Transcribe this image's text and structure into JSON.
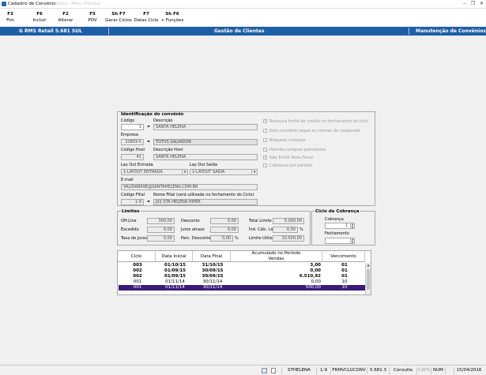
{
  "window": {
    "title": "Cadastro de Convênio",
    "ghost_title": "· Cadastro · Menu Principal"
  },
  "toolbar": [
    {
      "key": "F3",
      "label": "Fim"
    },
    {
      "key": "F6",
      "label": "Incluir"
    },
    {
      "key": "F2",
      "label": "Alterar"
    },
    {
      "key": "F5",
      "label": "PDV"
    },
    {
      "key": "Sh F7",
      "label": "Gerar Ciclos"
    },
    {
      "key": "F7",
      "label": "Datas Ciclo"
    },
    {
      "key": "Sh F6",
      "label": "+ Funções"
    }
  ],
  "header": {
    "app": "G RMS Retail 5.681 SUL",
    "module": "Gestão de Clientes",
    "screen": "Manutenção de Convênios"
  },
  "identificacao": {
    "title": "Identificação do convênio",
    "codigo_label": "Código",
    "codigo": "1",
    "descricao_label": "Descrição",
    "descricao": "SANTA HELENA",
    "empresa_label": "Empresa",
    "empresa_codigo": "22803-5",
    "empresa_nome": "TOTVS SALVADOR",
    "codigo_host_label": "Código Host",
    "codigo_host": "41",
    "descricao_host_label": "Descrição Host",
    "descricao_host": "SANTA HELENA",
    "layout_entrada_label": "Lay Out Entrada",
    "layout_entrada": "1-LAYOUT ENTRADA",
    "layout_saida_label": "Lay Out Saída",
    "layout_saida": "2-LAYOUT SAÍDA",
    "email_label": "E-mail",
    "email": "VALIDABASE@SANTAHELENA.COM.BR",
    "codigo_filial_label": "Código Filial",
    "codigo_filial": "1-9",
    "nome_filial_label": "Nome Filial (será utilizada no fechamento do Ciclo)",
    "nome_filial": "J01 STA HELENA HIPER"
  },
  "options": [
    {
      "label": "Restaura limite de crédito no fechamento do ciclo",
      "checked": true
    },
    {
      "label": "Este convênio segue as normas de cooperado",
      "checked": false
    },
    {
      "label": "Bloquear compras",
      "checked": false
    },
    {
      "label": "Permite compras parceladas",
      "checked": false
    },
    {
      "label": "Não Emitir Nota Fiscal",
      "checked": true
    },
    {
      "label": "Cobrança por período",
      "checked": false
    }
  ],
  "limites": {
    "title": "Limites",
    "off_line_label": "Off-Line",
    "off_line": "300,00",
    "desconto_label": "Desconto",
    "desconto": "0,00",
    "total_limite_label": "Total Limite",
    "total_limite": "5.000,00",
    "excedido_label": "Excedido",
    "excedido": "0,00",
    "juros_atraso_label": "Juros atraso",
    "juros_atraso": "0,00",
    "ind_calc_label": "Índ. Cálc. Lim.",
    "ind_calc": "0,00",
    "ind_calc_unit": "%",
    "taxa_juros_label": "Taxa de Juros",
    "taxa_juros": "0,00",
    "perc_desconto_label": "Perc. Desconto",
    "perc_desconto": "0,00",
    "perc_unit": "%",
    "limite_utilizado_label": "Limite Utilizado",
    "limite_utilizado": "10.500,00"
  },
  "ciclo": {
    "title": "Ciclo de Cobrança",
    "cobranca_label": "Cobrança",
    "cobranca": "1",
    "fechamento_label": "Fechamento",
    "fechamento": ""
  },
  "grid": {
    "headers": {
      "ciclo": "Ciclo",
      "data_inicial": "Data Inicial",
      "data_final": "Data Final",
      "acumulado": "Acumulado no Período",
      "vendas": "Vendas",
      "vencimento": "Vencimento"
    },
    "rows": [
      {
        "ciclo": "003",
        "inicio": "01/10/15",
        "fim": "31/10/15",
        "vendas": "3,00",
        "venc": "01",
        "style": "bold"
      },
      {
        "ciclo": "002",
        "inicio": "01/09/15",
        "fim": "30/09/15",
        "vendas": "0,00",
        "venc": "01",
        "style": "bold"
      },
      {
        "ciclo": "002",
        "inicio": "01/09/15",
        "fim": "30/09/15",
        "vendas": "6.510,92",
        "venc": "01",
        "style": "bold"
      },
      {
        "ciclo": "001",
        "inicio": "01/11/14",
        "fim": "30/11/14",
        "vendas": "0,00",
        "venc": "10",
        "style": "plain"
      },
      {
        "ciclo": "001",
        "inicio": "01/11/14",
        "fim": "30/11/14",
        "vendas": "500,00",
        "venc": "10",
        "style": "sel"
      }
    ]
  },
  "status": {
    "user": "STHELENA",
    "filial": "1-9",
    "program": "FRMVCLUCONV",
    "version": "5.681.3",
    "mode": "Consulta",
    "caps": "CAPS",
    "num": "NUM",
    "date": "15/04/2016"
  }
}
